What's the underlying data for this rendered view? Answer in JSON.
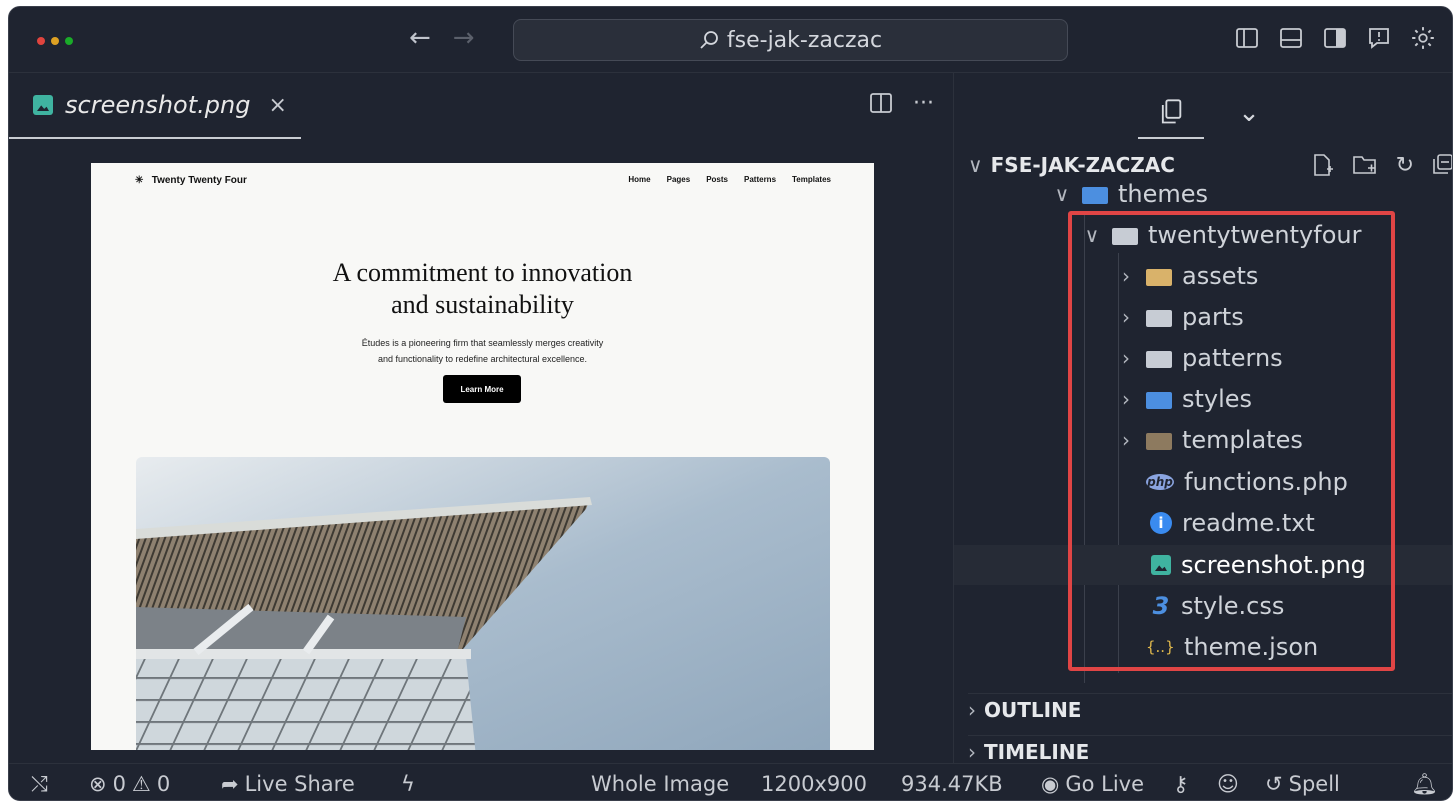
{
  "titlebar": {
    "search_text": "fse-jak-zaczac",
    "traffic_colors": [
      "#e0443e",
      "#dea123",
      "#1aab29"
    ],
    "icons": [
      "toggle-primary-sidebar-icon",
      "toggle-panel-icon",
      "toggle-secondary-sidebar-icon",
      "feedback-icon",
      "settings-gear-icon"
    ]
  },
  "editor": {
    "tab_label": "screenshot.png",
    "tab_close": "×",
    "more_glyph": "···",
    "preview": {
      "site_title": "Twenty Twenty Four",
      "nav": [
        "Home",
        "Pages",
        "Posts",
        "Patterns",
        "Templates"
      ],
      "hero_title_line1": "A commitment to innovation",
      "hero_title_line2": "and sustainability",
      "hero_text_line1": "Études is a pioneering firm that seamlessly merges creativity",
      "hero_text_line2": "and functionality to redefine architectural excellence.",
      "hero_button": "Learn More"
    }
  },
  "sidebar": {
    "root_label": "FSE-JAK-ZACZAC",
    "themes_label": "themes",
    "theme_folder": "twentytwentyfour",
    "folders": [
      {
        "label": "assets",
        "color": "#d9b26a"
      },
      {
        "label": "parts",
        "color": "#c7ccd4"
      },
      {
        "label": "patterns",
        "color": "#c7ccd4"
      },
      {
        "label": "styles",
        "color": "#4c8fe0"
      },
      {
        "label": "templates",
        "color": "#8d7a5f"
      }
    ],
    "files": [
      {
        "label": "functions.php",
        "icon": "php-icon",
        "glyph": "php",
        "color": "#8aa4e0"
      },
      {
        "label": "readme.txt",
        "icon": "info-icon",
        "glyph": "i",
        "color": "#3a8bf0"
      },
      {
        "label": "screenshot.png",
        "icon": "image-file-icon",
        "glyph": "",
        "color": "#3fb3a0"
      },
      {
        "label": "style.css",
        "icon": "css-icon",
        "glyph": "3",
        "color": "#4c8fe0"
      },
      {
        "label": "theme.json",
        "icon": "json-icon",
        "glyph": "{..}",
        "color": "#e0b84c"
      }
    ],
    "outline_label": "OUTLINE",
    "timeline_label": "TIMELINE",
    "highlight_color": "#e04545"
  },
  "statusbar": {
    "errors": "0",
    "warnings": "0",
    "live_share": "Live Share",
    "whole_image": "Whole Image",
    "dimensions": "1200x900",
    "file_size": "934.47KB",
    "go_live": "Go Live",
    "spell": "Spell"
  }
}
